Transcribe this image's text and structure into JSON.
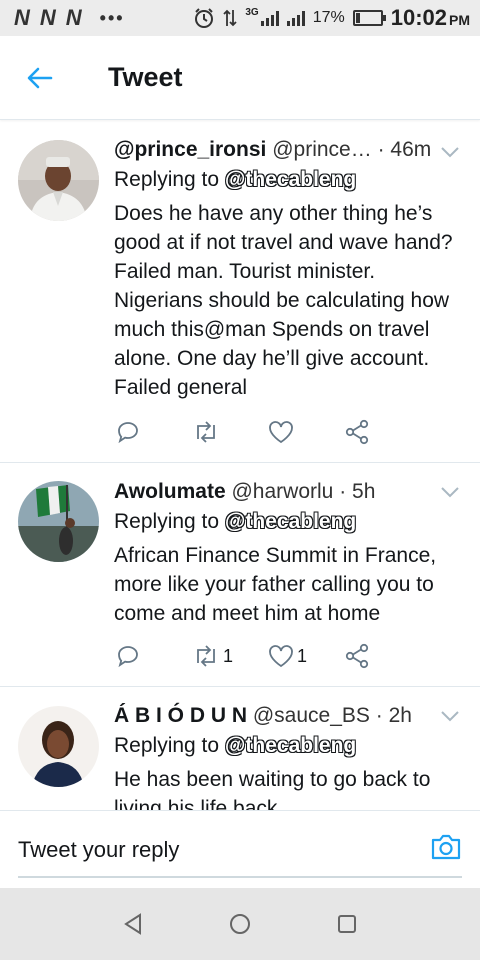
{
  "status_bar": {
    "carrier_icons": [
      "N",
      "N",
      "N"
    ],
    "dots": "•••",
    "network": "3G",
    "battery": "17%",
    "battery_level": 0.17,
    "time": "10:02",
    "ampm": "PM"
  },
  "header": {
    "title": "Tweet"
  },
  "tweets": [
    {
      "name": "@prince_ironsi",
      "handle": "@prince…",
      "time": "· 46m",
      "reply_label": "Replying to",
      "reply_to": "@thecableng",
      "text": "Does he have any other thing he’s good at if not travel and wave hand? Failed man. Tourist minister. Nigerians should be calculating how much this@man Spends on travel alone. One day he’ll give account. Failed general",
      "retweets": "",
      "likes": ""
    },
    {
      "name": "Awolumate",
      "handle": "@harworlu",
      "time": "· 5h",
      "reply_label": "Replying to",
      "reply_to": "@thecableng",
      "text": "African Finance Summit in France, more like your father calling you to come and meet him at home",
      "retweets": "1",
      "likes": "1"
    },
    {
      "name": "Á B I Ó D U N",
      "handle": "@sauce_BS",
      "time": "· 2h",
      "reply_label": "Replying to",
      "reply_to": "@thecableng",
      "text": "He has been waiting to go back to living his life back",
      "retweets": "",
      "likes": ""
    }
  ],
  "reply_bar": {
    "placeholder": "Tweet your reply"
  },
  "colors": {
    "accent": "#1da1f2",
    "icon_gray": "#657786",
    "divider": "#e1e8ed"
  }
}
